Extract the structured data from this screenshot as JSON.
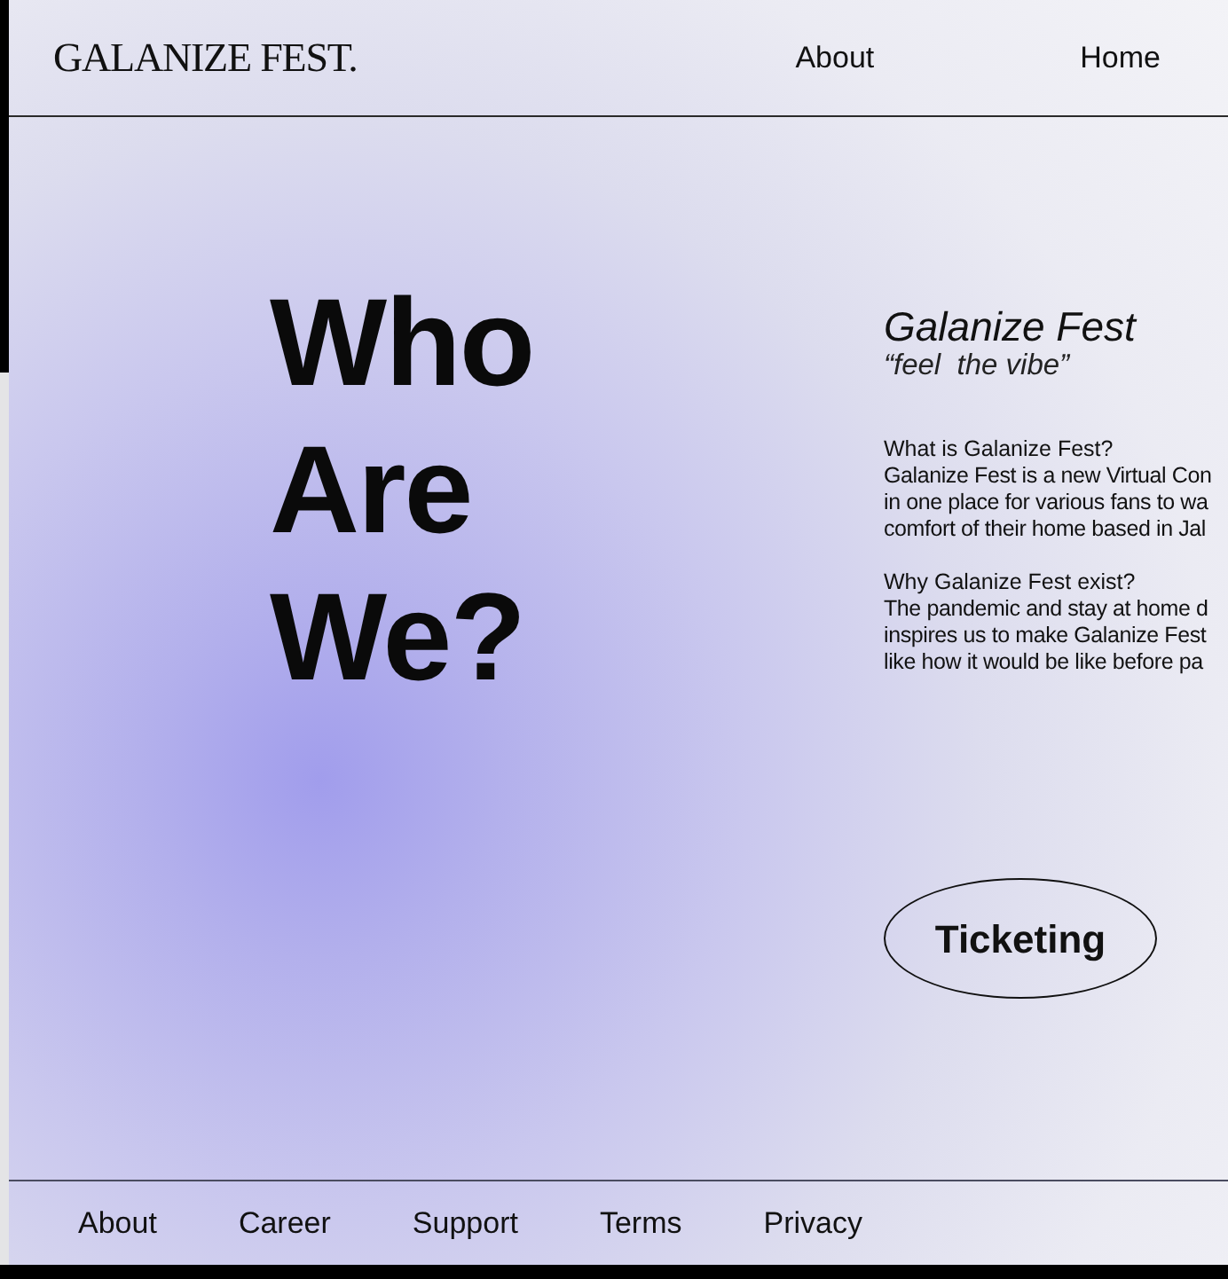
{
  "header": {
    "logo": "GALANIZE FEST.",
    "nav": [
      {
        "label": "About"
      },
      {
        "label": "Home"
      }
    ]
  },
  "hero": {
    "heading": "Who Are We?"
  },
  "intro": {
    "title": "Galanize Fest",
    "tagline": "“feel  the vibe”",
    "sections": [
      {
        "question": "What is Galanize Fest?",
        "lines": [
          "Galanize Fest is a new Virtual Con",
          "in one place for various fans to wa",
          "comfort of their home based in Jal"
        ]
      },
      {
        "question": "Why Galanize Fest exist?",
        "lines": [
          "The pandemic and stay at home d",
          "inspires us to make Galanize Fest",
          "like how it would be like before pa"
        ]
      }
    ]
  },
  "cta": {
    "label": "Ticketing"
  },
  "footer": {
    "links": [
      "About",
      "Career",
      "Support",
      "Terms",
      "Privacy"
    ]
  }
}
